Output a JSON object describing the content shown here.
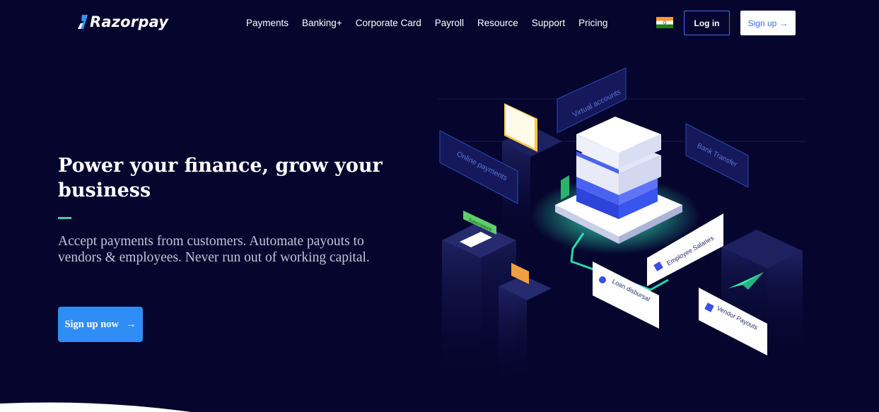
{
  "brand": {
    "name": "Razorpay"
  },
  "nav": {
    "items": [
      "Payments",
      "Banking+",
      "Corporate Card",
      "Payroll",
      "Resource",
      "Support",
      "Pricing"
    ],
    "login_label": "Log in",
    "signup_label": "Sign up",
    "signup_arrow": "→"
  },
  "hero": {
    "headline": "Power your finance, grow your business",
    "subtext": "Accept payments from customers. Automate payouts to vendors & employees. Never run out of working capital.",
    "cta_label": "Sign up now",
    "cta_arrow": "→"
  },
  "illustration": {
    "labels": {
      "virtual_accounts": "Virtual accounts",
      "online_payments": "Online payments",
      "bank_transfer": "Bank Transfer",
      "subscriptions": "Subscriptions",
      "employee_salaries": "Employee Salaries",
      "loan_disbursal": "Loan disbursal",
      "vendor_payouts": "Vendor Payouts"
    }
  },
  "colors": {
    "background": "#05052e",
    "accent_blue": "#2f8ef5",
    "accent_green": "#4bcf9c"
  },
  "icons": [
    "razorpay-logo-icon",
    "india-flag-icon",
    "arrow-right-icon"
  ]
}
